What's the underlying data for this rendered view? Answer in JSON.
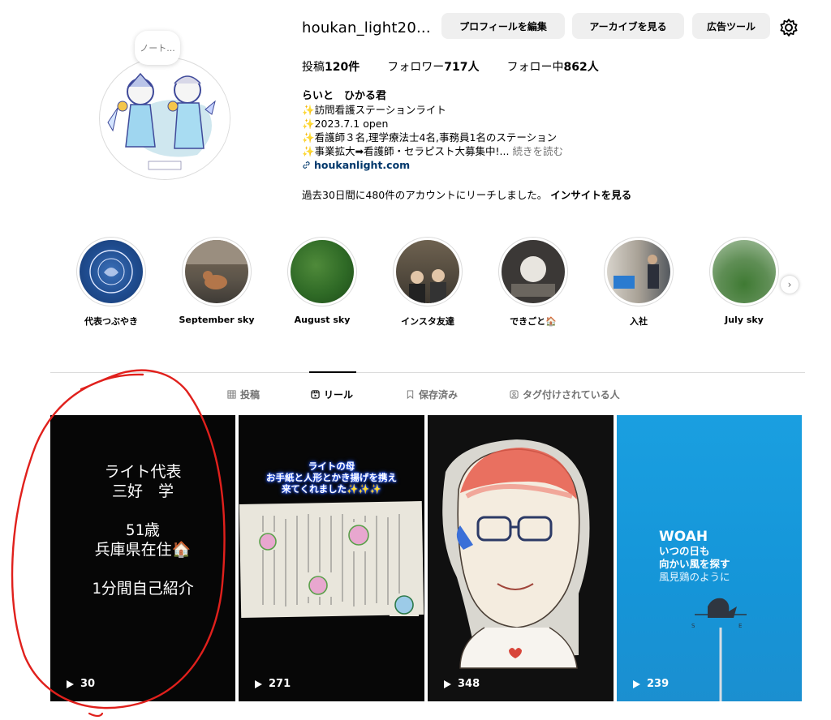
{
  "profile": {
    "username": "houkan_light20...",
    "note": "ノート...",
    "buttons": {
      "edit": "プロフィールを編集",
      "archive": "アーカイブを見る",
      "ad_tools": "広告ツール"
    },
    "stats": {
      "posts_label": "投稿",
      "posts_value": "120件",
      "followers_label": "フォロワー",
      "followers_value": "717人",
      "following_label": "フォロー中",
      "following_value": "862人"
    },
    "bio": {
      "name": "らいと　ひかる君",
      "lines": [
        "✨訪問看護ステーションライト",
        "✨2023.7.1 open",
        "✨看護師３名,理学療法士4名,事務員1名のステーション",
        "✨事業拡大➡看護師・セラピスト大募集中!..."
      ],
      "more": "続きを読む",
      "link": "houkanlight.com"
    },
    "reach_text": "過去30日間に480件のアカウントにリーチしました。",
    "insights_label": "インサイトを見る"
  },
  "highlights": [
    {
      "label": "代表つぶやき"
    },
    {
      "label": "September sky"
    },
    {
      "label": "August sky"
    },
    {
      "label": "インスタ友達"
    },
    {
      "label": "できごと🏠"
    },
    {
      "label": "入社"
    },
    {
      "label": "July sky"
    }
  ],
  "tabs": [
    {
      "label": "投稿"
    },
    {
      "label": "リール"
    },
    {
      "label": "保存済み"
    },
    {
      "label": "タグ付けされている人"
    }
  ],
  "reels": [
    {
      "plays": "30",
      "text_lines": [
        "ライト代表",
        "三好　学",
        "",
        "51歳",
        "兵庫県在住🏠",
        "",
        "1分間自己紹介"
      ]
    },
    {
      "plays": "271",
      "caption_lines": [
        "ライトの母",
        "お手紙と人形とかき揚げを携え",
        "来てくれました✨✨✨"
      ]
    },
    {
      "plays": "348"
    },
    {
      "plays": "239",
      "woah": "WOAH",
      "lines": [
        "いつの日も",
        "向かい風を探す",
        "風見鶏のように"
      ]
    }
  ],
  "colors": {
    "link": "#00376b",
    "button_bg": "#efefef",
    "annotation": "#e0201c",
    "muted": "#737373"
  }
}
